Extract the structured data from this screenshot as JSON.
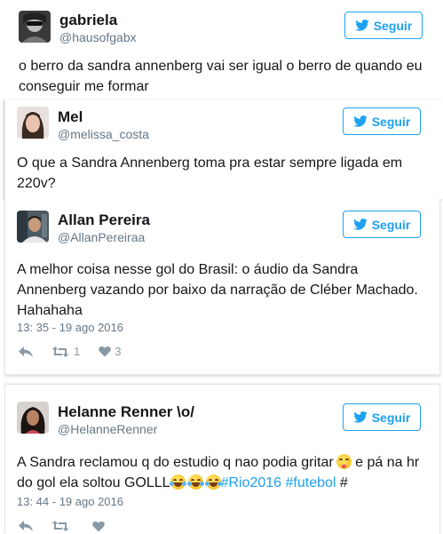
{
  "tweets": [
    {
      "name": "gabriela",
      "handle": "@hausofgabx",
      "follow_label": "Seguir",
      "lines": [
        "o berro da sandra annenberg vai ser igual o berro de quando eu",
        "conseguir me formar"
      ]
    },
    {
      "name": "Mel",
      "handle": "@melissa_costa",
      "follow_label": "Seguir",
      "lines": [
        "O que a Sandra Annenberg toma pra estar sempre ligada em",
        "220v?"
      ]
    },
    {
      "name": "Allan Pereira",
      "handle": "@AllanPereiraa",
      "follow_label": "Seguir",
      "lines": [
        "A melhor coisa nesse gol do Brasil: o áudio da Sandra",
        "Annenberg vazando por baixo da narração de Cléber Machado.",
        "Hahahaha"
      ],
      "timestamp": "13: 35 - 19 ago 2016",
      "retweets": "1",
      "likes": "3"
    },
    {
      "name": "Helanne Renner \\o/",
      "handle": "@HelanneRenner",
      "follow_label": "Seguir",
      "line1": "A Sandra reclamou q do estudio q nao podia gritar",
      "line1_after": " e pá na hr",
      "line2_before": "do gol ela soltou GOLLL",
      "hashtag1": "#Rio2016",
      "hashtag2": "#futebol",
      "line2_after": " #",
      "timestamp": "13: 44 - 19 ago 2016"
    }
  ],
  "colors": {
    "accent": "#1da1f2",
    "text": "#14171a",
    "muted": "#657786",
    "icon": "#8899a6"
  },
  "icons": [
    "twitter-bird-icon",
    "reply-icon",
    "retweet-icon",
    "heart-icon",
    "winking-tongue-emoji",
    "tears-of-joy-emoji"
  ]
}
